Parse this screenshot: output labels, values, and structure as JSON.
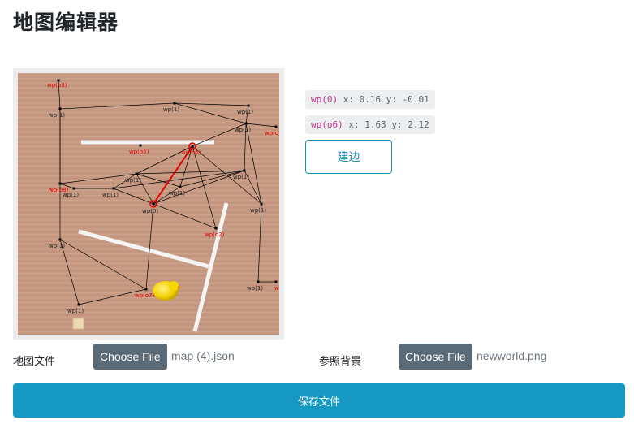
{
  "page": {
    "title": "地图编辑器"
  },
  "map": {
    "background": "#c69a82",
    "line_color": "#000000",
    "selected_edge_color": "#e00000",
    "label_color_default": "#222222",
    "label_color_obstacle": "#e00000",
    "waypoints": [
      {
        "label": "wp(o3)"
      },
      {
        "label": "wp(1)"
      },
      {
        "label": "wp(1)"
      },
      {
        "label": "wp(1)"
      },
      {
        "label": "wp(1)"
      },
      {
        "label": "wp(o1)"
      },
      {
        "label": "wp(o5)"
      },
      {
        "label": "wp(o6)"
      },
      {
        "label": "wp(1)"
      },
      {
        "label": "wp(1)"
      },
      {
        "label": "wp(o8)"
      },
      {
        "label": "wp(1)"
      },
      {
        "label": "wp(1)"
      },
      {
        "label": "wp(1)"
      },
      {
        "label": "wp(0)"
      },
      {
        "label": "wp(1)"
      },
      {
        "label": "wp(o2)"
      },
      {
        "label": "wp(1)"
      },
      {
        "label": "wp(o7)"
      },
      {
        "label": "wp(1)"
      },
      {
        "label": "wp(1)"
      },
      {
        "label": "wp(o4)"
      }
    ]
  },
  "selection": {
    "from": {
      "name": "wp(0)",
      "x_label": "x:",
      "x": "0.16",
      "y_label": "y:",
      "y": "-0.01"
    },
    "to": {
      "name": "wp(o6)",
      "x_label": "x:",
      "x": "1.63",
      "y_label": "y:",
      "y": "2.12"
    }
  },
  "actions": {
    "build_edge": "建边",
    "save_file": "保存文件"
  },
  "files": {
    "map_label": "地图文件",
    "map_button": "Choose File",
    "map_filename": "map (4).json",
    "bg_label": "参照背景",
    "bg_button": "Choose File",
    "bg_filename": "newworld.png"
  }
}
